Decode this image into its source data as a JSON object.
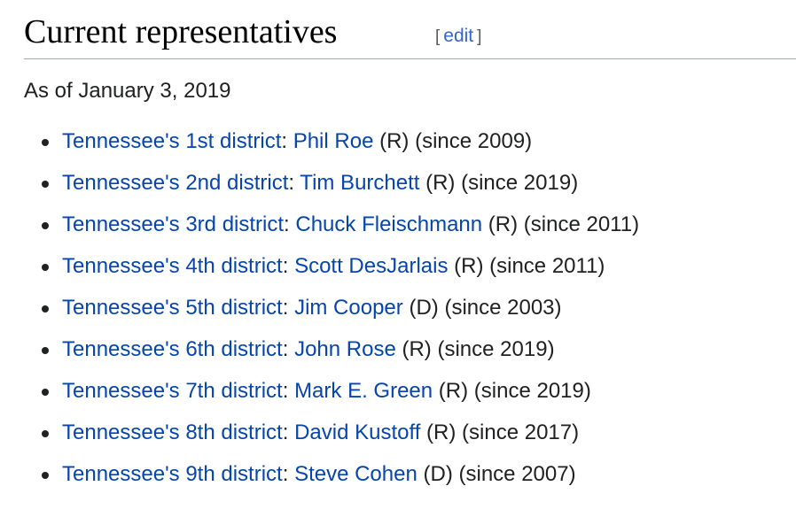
{
  "section": {
    "title": "Current representatives",
    "edit_open": "[",
    "edit_label": "edit",
    "edit_close": "]",
    "as_of": "As of January 3, 2019"
  },
  "representatives": [
    {
      "district": "Tennessee's 1st district",
      "name": "Phil Roe",
      "party": "(R)",
      "since": "(since 2009)"
    },
    {
      "district": "Tennessee's 2nd district",
      "name": "Tim Burchett",
      "party": "(R)",
      "since": "(since 2019)"
    },
    {
      "district": "Tennessee's 3rd district",
      "name": "Chuck Fleischmann",
      "party": "(R)",
      "since": "(since 2011)"
    },
    {
      "district": "Tennessee's 4th district",
      "name": "Scott DesJarlais",
      "party": "(R)",
      "since": "(since 2011)"
    },
    {
      "district": "Tennessee's 5th district",
      "name": "Jim Cooper",
      "party": "(D)",
      "since": "(since 2003)"
    },
    {
      "district": "Tennessee's 6th district",
      "name": "John Rose",
      "party": "(R)",
      "since": "(since 2019)"
    },
    {
      "district": "Tennessee's 7th district",
      "name": "Mark E. Green",
      "party": "(R)",
      "since": "(since 2019)"
    },
    {
      "district": "Tennessee's 8th district",
      "name": "David Kustoff",
      "party": "(R)",
      "since": "(since 2017)"
    },
    {
      "district": "Tennessee's 9th district",
      "name": "Steve Cohen",
      "party": "(D)",
      "since": "(since 2007)"
    }
  ],
  "colors": {
    "link": "#0645ad",
    "edit_link": "#3366cc",
    "text": "#202122",
    "rule": "#a2a9b1"
  }
}
